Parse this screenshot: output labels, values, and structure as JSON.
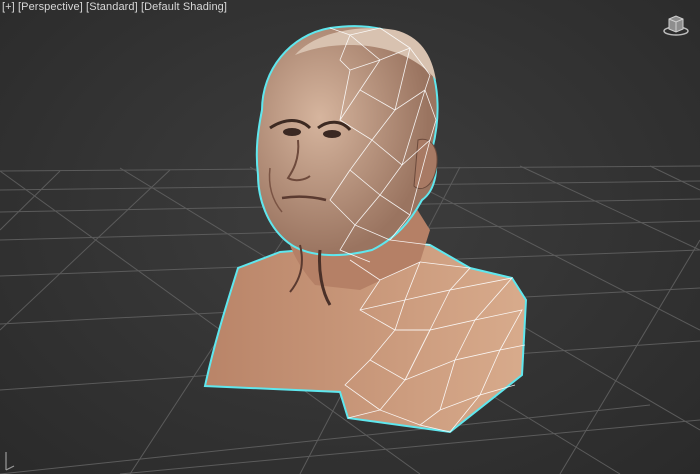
{
  "viewport": {
    "label_plus": "[+]",
    "label_view": "[Perspective]",
    "label_shading_mode": "[Standard]",
    "label_shading": "[Default Shading]"
  },
  "viewcube": {
    "icon": "viewcube-icon"
  },
  "model": {
    "name": "head-bust",
    "wireframe_color": "#ffffff",
    "selection_outline": "#5fe7ee"
  },
  "colors": {
    "background": "#333333",
    "grid": "#5a5a5a",
    "skin": "#c99b7c"
  }
}
